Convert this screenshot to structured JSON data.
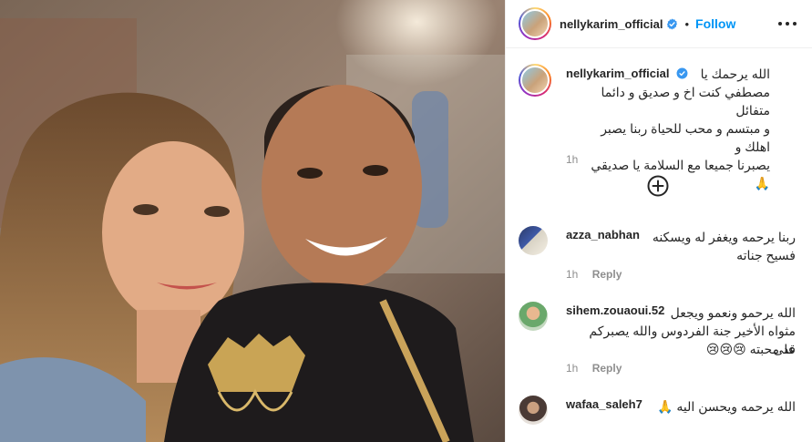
{
  "post": {
    "username": "nellykarim_official",
    "separator": "•",
    "follow_label": "Follow",
    "colors": {
      "accent": "#0095f6",
      "verified": "#3897f0",
      "muted": "#8e8e8e",
      "text": "#262626"
    }
  },
  "caption": {
    "username": "nellykarim_official",
    "line1": "الله يرحمك يا",
    "line2": "مصطفي كنت اخ و صديق و دائما متفائل",
    "line3": "و مبتسم و محب للحياة ربنا يصبر اهلك و",
    "line4": "يصبرنا جميعا مع السلامة يا صديقي 🙏",
    "time": "1h"
  },
  "icons": {
    "verified": "verified-badge-icon",
    "more": "more-options-icon",
    "load_more": "plus-circle-icon"
  },
  "comments": [
    {
      "username": "azza_nabhan",
      "line1": "ربنا يرحمه ويغفر له ويسكنه",
      "line2": "فسيح جناته",
      "time": "1h",
      "reply": "Reply"
    },
    {
      "username": "sihem.zouaoui.52",
      "line1": "الله يرحمو ونعمو ويجعل",
      "line2": "مثواه الأخير جنة الفردوس والله يصبركم على",
      "line3": "قد محبته 😢😢😢",
      "time": "1h",
      "reply": "Reply"
    },
    {
      "username": "wafaa_saleh7",
      "line1": "الله يرحمه ويحسن اليه 🙏"
    }
  ]
}
